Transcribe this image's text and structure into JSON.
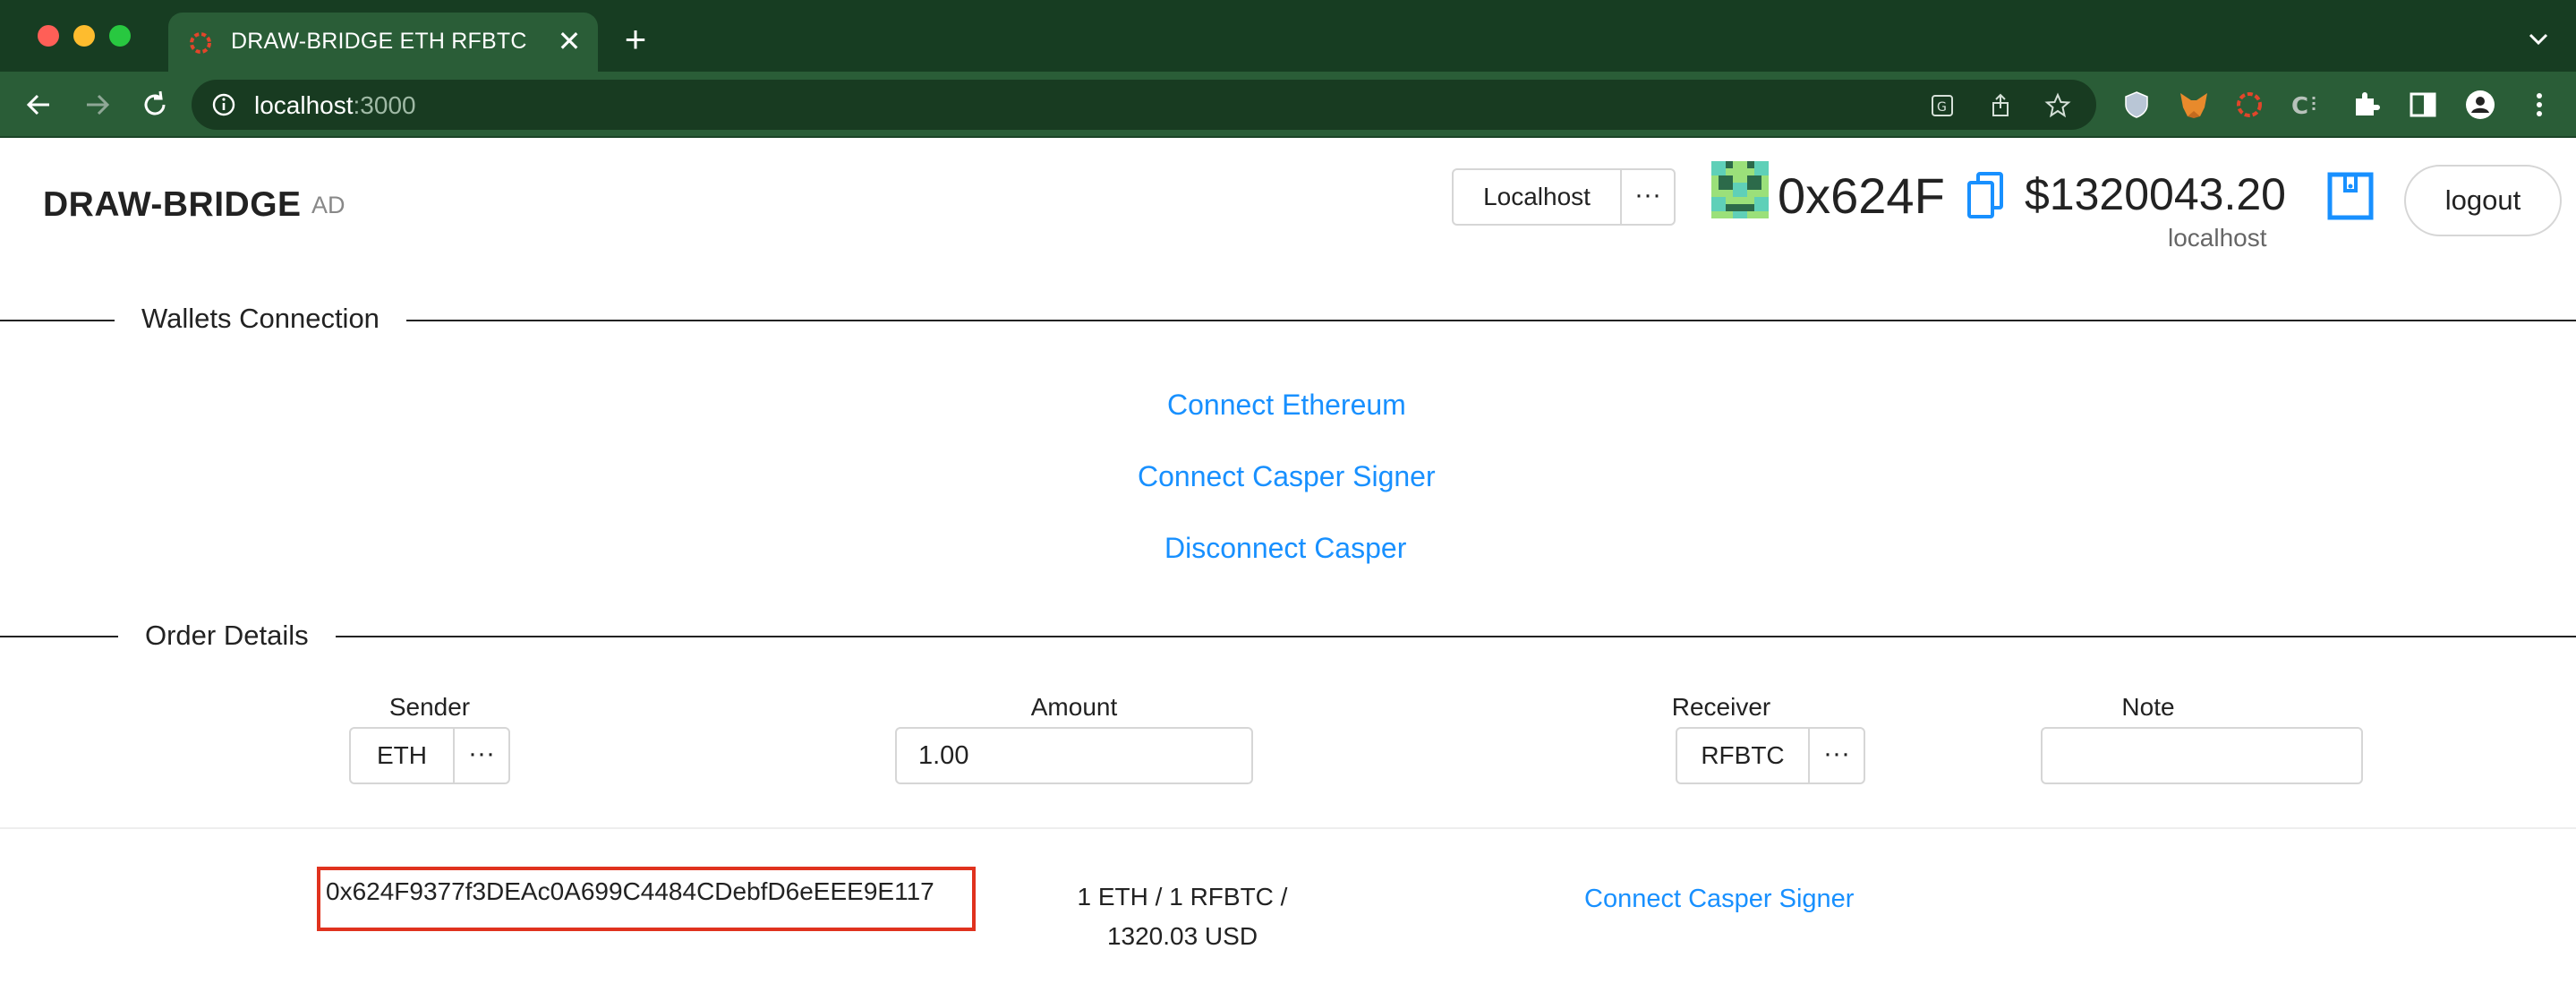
{
  "browser": {
    "tab_title": "DRAW-BRIDGE ETH RFBTC",
    "tab_close": "✕",
    "new_tab": "+",
    "url_host": "localhost",
    "url_port": ":3000"
  },
  "header": {
    "brand": "DRAW-BRIDGE",
    "brand_sub": "AD",
    "network_label": "Localhost",
    "network_more": "···",
    "address_short": "0x624F",
    "balance": "$1320043.20",
    "balance_network": "localhost",
    "logout_label": "logout"
  },
  "wallets": {
    "section_title": "Wallets Connection",
    "connect_ethereum": "Connect Ethereum",
    "connect_casper": "Connect Casper Signer",
    "disconnect_casper": "Disconnect Casper"
  },
  "order": {
    "section_title": "Order Details",
    "sender_label": "Sender",
    "sender_value": "ETH",
    "amount_label": "Amount",
    "amount_value": "1.00",
    "receiver_label": "Receiver",
    "receiver_value": "RFBTC",
    "note_label": "Note",
    "note_value": "",
    "more": "···"
  },
  "summary": {
    "sender_address": "0x624F9377f3DEAc0A699C4484CDebfD6eEEE9E117",
    "rate_line1": "1 ETH / 1 RFBTC /",
    "rate_line2": "1320.03 USD",
    "receiver_action": "Connect Casper Signer"
  },
  "colors": {
    "link": "#1890ff",
    "chrome_dark": "#173d22",
    "chrome_tab": "#2a5d37",
    "highlight_box": "#e0321e"
  }
}
